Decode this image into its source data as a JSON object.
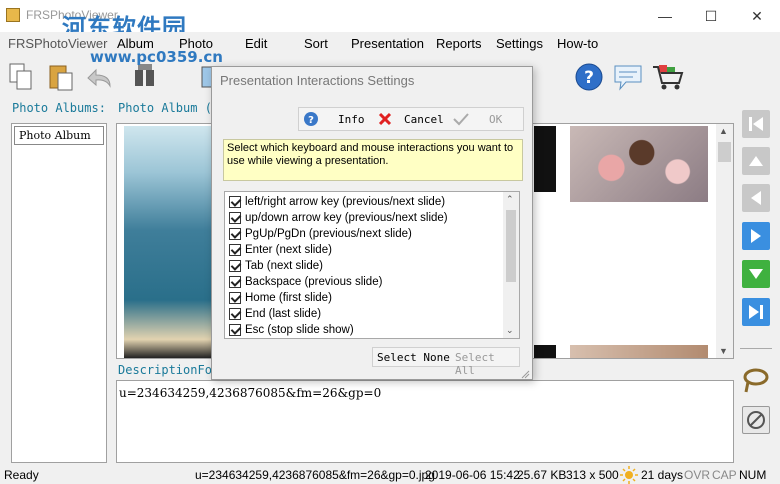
{
  "window": {
    "title": "FRSPhotoViewer",
    "watermark": "河东软件园",
    "watermark_url": "www.pc0359.cn"
  },
  "menu": [
    "FRSPhotoViewer",
    "Album",
    "Photo",
    "Edit",
    "Sort",
    "Presentation",
    "Reports",
    "Settings",
    "How-to"
  ],
  "panels": {
    "albums_label": "Photo Albums:",
    "album_label": "Photo Album (",
    "album_item": "Photo Album",
    "description_label": "DescriptionFo",
    "description_text": "u=234634259,4236876085&fm=26&gp=0"
  },
  "dialog": {
    "title": "Presentation Interactions Settings",
    "toolbar": {
      "info": "Info",
      "cancel": "Cancel",
      "ok": "OK"
    },
    "info_text": "Select which keyboard and mouse interactions you want to use while viewing a presentation.",
    "options": [
      "left/right arrow key (previous/next slide)",
      "up/down arrow key (previous/next slide)",
      "PgUp/PgDn (previous/next slide)",
      "Enter (next slide)",
      "Tab (next slide)",
      "Backspace (previous slide)",
      "Home (first slide)",
      "End (last slide)",
      "Esc (stop slide show)"
    ],
    "select_none": "Select None",
    "select_all": "Select All"
  },
  "status": {
    "ready": "Ready",
    "file": "u=234634259,4236876085&fm=26&gp=0.jpg",
    "date": "2019-06-06 15:42",
    "size": "25.67 KB",
    "dims": "313 x 500",
    "days": "21 days",
    "ovr": "OVR",
    "cap": "CAP",
    "num": "NUM"
  },
  "colors": {
    "accent_blue": "#2f79c0",
    "label_teal": "#1a7a9a",
    "info_yellow": "#ffffc4",
    "nav_blue": "#3a8fe0",
    "nav_green": "#3fb13f"
  }
}
